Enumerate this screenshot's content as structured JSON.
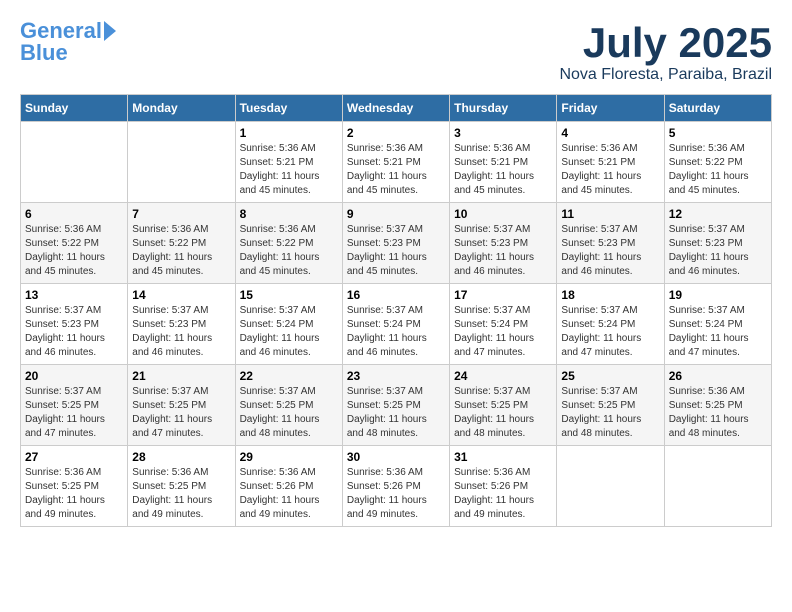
{
  "logo": {
    "line1": "General",
    "line2": "Blue"
  },
  "title": {
    "month": "July 2025",
    "location": "Nova Floresta, Paraiba, Brazil"
  },
  "weekdays": [
    "Sunday",
    "Monday",
    "Tuesday",
    "Wednesday",
    "Thursday",
    "Friday",
    "Saturday"
  ],
  "weeks": [
    [
      {
        "day": "",
        "info": ""
      },
      {
        "day": "",
        "info": ""
      },
      {
        "day": "1",
        "info": "Sunrise: 5:36 AM\nSunset: 5:21 PM\nDaylight: 11 hours and 45 minutes."
      },
      {
        "day": "2",
        "info": "Sunrise: 5:36 AM\nSunset: 5:21 PM\nDaylight: 11 hours and 45 minutes."
      },
      {
        "day": "3",
        "info": "Sunrise: 5:36 AM\nSunset: 5:21 PM\nDaylight: 11 hours and 45 minutes."
      },
      {
        "day": "4",
        "info": "Sunrise: 5:36 AM\nSunset: 5:21 PM\nDaylight: 11 hours and 45 minutes."
      },
      {
        "day": "5",
        "info": "Sunrise: 5:36 AM\nSunset: 5:22 PM\nDaylight: 11 hours and 45 minutes."
      }
    ],
    [
      {
        "day": "6",
        "info": "Sunrise: 5:36 AM\nSunset: 5:22 PM\nDaylight: 11 hours and 45 minutes."
      },
      {
        "day": "7",
        "info": "Sunrise: 5:36 AM\nSunset: 5:22 PM\nDaylight: 11 hours and 45 minutes."
      },
      {
        "day": "8",
        "info": "Sunrise: 5:36 AM\nSunset: 5:22 PM\nDaylight: 11 hours and 45 minutes."
      },
      {
        "day": "9",
        "info": "Sunrise: 5:37 AM\nSunset: 5:23 PM\nDaylight: 11 hours and 45 minutes."
      },
      {
        "day": "10",
        "info": "Sunrise: 5:37 AM\nSunset: 5:23 PM\nDaylight: 11 hours and 46 minutes."
      },
      {
        "day": "11",
        "info": "Sunrise: 5:37 AM\nSunset: 5:23 PM\nDaylight: 11 hours and 46 minutes."
      },
      {
        "day": "12",
        "info": "Sunrise: 5:37 AM\nSunset: 5:23 PM\nDaylight: 11 hours and 46 minutes."
      }
    ],
    [
      {
        "day": "13",
        "info": "Sunrise: 5:37 AM\nSunset: 5:23 PM\nDaylight: 11 hours and 46 minutes."
      },
      {
        "day": "14",
        "info": "Sunrise: 5:37 AM\nSunset: 5:23 PM\nDaylight: 11 hours and 46 minutes."
      },
      {
        "day": "15",
        "info": "Sunrise: 5:37 AM\nSunset: 5:24 PM\nDaylight: 11 hours and 46 minutes."
      },
      {
        "day": "16",
        "info": "Sunrise: 5:37 AM\nSunset: 5:24 PM\nDaylight: 11 hours and 46 minutes."
      },
      {
        "day": "17",
        "info": "Sunrise: 5:37 AM\nSunset: 5:24 PM\nDaylight: 11 hours and 47 minutes."
      },
      {
        "day": "18",
        "info": "Sunrise: 5:37 AM\nSunset: 5:24 PM\nDaylight: 11 hours and 47 minutes."
      },
      {
        "day": "19",
        "info": "Sunrise: 5:37 AM\nSunset: 5:24 PM\nDaylight: 11 hours and 47 minutes."
      }
    ],
    [
      {
        "day": "20",
        "info": "Sunrise: 5:37 AM\nSunset: 5:25 PM\nDaylight: 11 hours and 47 minutes."
      },
      {
        "day": "21",
        "info": "Sunrise: 5:37 AM\nSunset: 5:25 PM\nDaylight: 11 hours and 47 minutes."
      },
      {
        "day": "22",
        "info": "Sunrise: 5:37 AM\nSunset: 5:25 PM\nDaylight: 11 hours and 48 minutes."
      },
      {
        "day": "23",
        "info": "Sunrise: 5:37 AM\nSunset: 5:25 PM\nDaylight: 11 hours and 48 minutes."
      },
      {
        "day": "24",
        "info": "Sunrise: 5:37 AM\nSunset: 5:25 PM\nDaylight: 11 hours and 48 minutes."
      },
      {
        "day": "25",
        "info": "Sunrise: 5:37 AM\nSunset: 5:25 PM\nDaylight: 11 hours and 48 minutes."
      },
      {
        "day": "26",
        "info": "Sunrise: 5:36 AM\nSunset: 5:25 PM\nDaylight: 11 hours and 48 minutes."
      }
    ],
    [
      {
        "day": "27",
        "info": "Sunrise: 5:36 AM\nSunset: 5:25 PM\nDaylight: 11 hours and 49 minutes."
      },
      {
        "day": "28",
        "info": "Sunrise: 5:36 AM\nSunset: 5:25 PM\nDaylight: 11 hours and 49 minutes."
      },
      {
        "day": "29",
        "info": "Sunrise: 5:36 AM\nSunset: 5:26 PM\nDaylight: 11 hours and 49 minutes."
      },
      {
        "day": "30",
        "info": "Sunrise: 5:36 AM\nSunset: 5:26 PM\nDaylight: 11 hours and 49 minutes."
      },
      {
        "day": "31",
        "info": "Sunrise: 5:36 AM\nSunset: 5:26 PM\nDaylight: 11 hours and 49 minutes."
      },
      {
        "day": "",
        "info": ""
      },
      {
        "day": "",
        "info": ""
      }
    ]
  ]
}
